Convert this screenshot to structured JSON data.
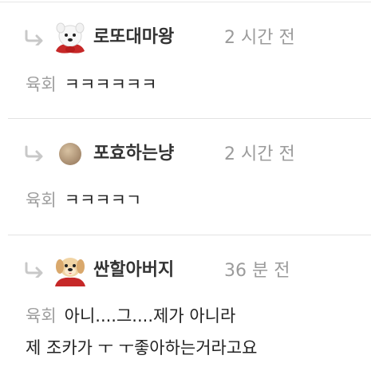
{
  "comments": [
    {
      "avatar_icon": "white-dog-with-red-cape-icon",
      "nickname": "로또대마왕",
      "time": "2 시간 전",
      "mention": "육회",
      "text": "ㅋㅋㅋㅋㅋㅋ"
    },
    {
      "avatar_icon": "brown-circle-icon",
      "nickname": "포효하는냥",
      "time": "2 시간 전",
      "mention": "육회",
      "text": "ㅋㅋㅋㅋㄱ"
    },
    {
      "avatar_icon": "puppy-with-red-cape-icon",
      "nickname": "싼할아버지",
      "time": "36 분 전",
      "mention": "육회",
      "text": "아니....그....제가 아니라",
      "text_line2": "제 조카가 ㅜ ㅜ좋아하는거라고요"
    }
  ],
  "colors": {
    "nickname": "#333333",
    "time": "#9b9b9b",
    "mention": "#9e9e9e",
    "divider": "#e3e3e3",
    "reply_arrow": "#c8c8c8"
  }
}
